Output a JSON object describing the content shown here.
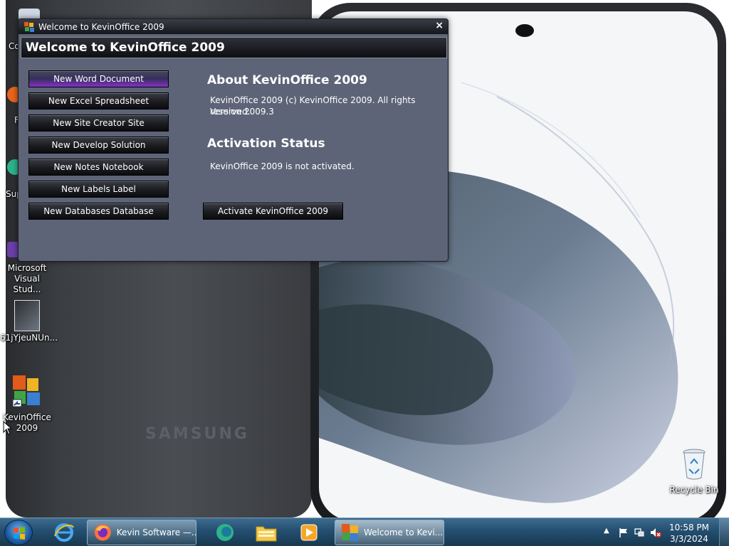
{
  "window": {
    "title": "Welcome to KevinOffice 2009",
    "header": "Welcome to KevinOffice 2009",
    "close_glyph": "×",
    "buttons": [
      "New Word Document",
      "New Excel Spreadsheet",
      "New Site Creator Site",
      "New Develop Solution",
      "New Notes Notebook",
      "New Labels Label",
      "New Databases Database"
    ],
    "about": {
      "title": "About KevinOffice 2009",
      "line1": "KevinOffice 2009 (c) KevinOffice 2009. All rights reserved.",
      "line2": "Version 2009.3"
    },
    "activation": {
      "title": "Activation Status",
      "status": "KevinOffice 2009 is not activated.",
      "button": "Activate KevinOffice 2009"
    }
  },
  "desktop": {
    "wallpaper_brand": "SAMSUNG",
    "icons": {
      "top_partial": "Co",
      "firefox_partial": "F",
      "support_partial": "Sup",
      "vs_line1": "Microsoft",
      "vs_line2": "Visual Stud...",
      "image_file": "61jYjeuNUn...",
      "kevinoffice_line1": "KevinOffice",
      "kevinoffice_line2": "2009",
      "recycle_bin": "Recycle Bin"
    }
  },
  "taskbar": {
    "tasks": [
      {
        "label": "Kevin Software —..."
      },
      {
        "label": "Welcome to Kevi..."
      }
    ],
    "clock": {
      "time": "10:58 PM",
      "date": "3/3/2024"
    }
  },
  "colors": {
    "window_bg": "#5d6477",
    "active_button_accent": "#8a2fc9",
    "taskbar": "#244e70"
  }
}
